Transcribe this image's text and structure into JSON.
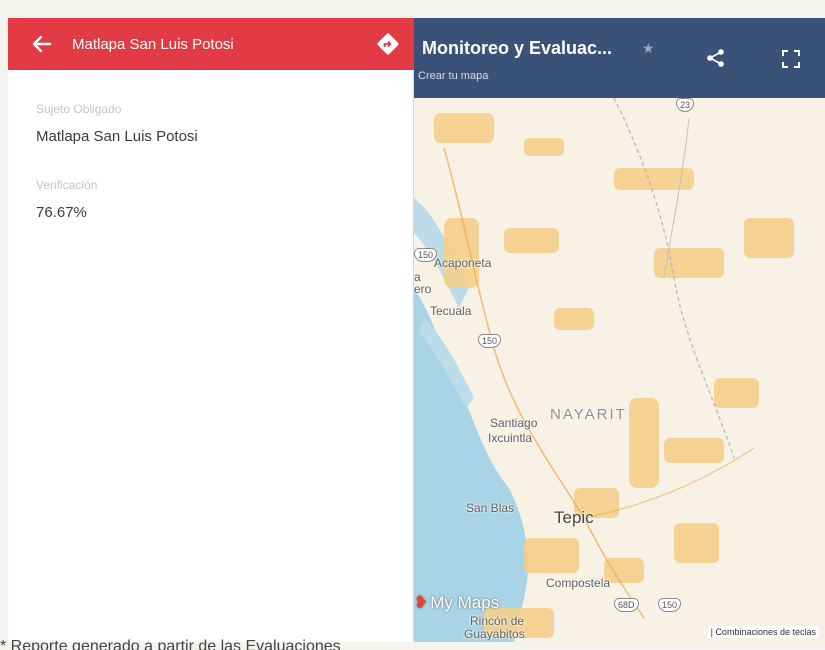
{
  "panel": {
    "title": "Matlapa San Luis Potosi",
    "fields": [
      {
        "label": "Sujeto Obligado",
        "value": "Matlapa San Luis Potosi"
      },
      {
        "label": "Verificación",
        "value": "76.67%"
      }
    ]
  },
  "map": {
    "title": "Monitoreo y Evaluac...",
    "subtitle": "Crear tu mapa",
    "places": [
      "Acaponeta",
      "Tecuala",
      "NAYARIT",
      "Santiago",
      "Ixcuintla",
      "San Blas",
      "Tepic",
      "Compostela",
      "Rincón de",
      "Guayabitos",
      "ero",
      "a"
    ],
    "shields": [
      "23",
      "150",
      "150",
      "68D",
      "150"
    ],
    "brand": "My Maps",
    "keyboard_shortcuts": "Combinaciones de teclas"
  },
  "footer": {
    "note": "* Reporte generado a partir de las Evaluaciones"
  },
  "colors": {
    "panel_header": "#e23b45",
    "map_header": "#3a5178",
    "water": "#a9d3e6",
    "land": "#f7f1e6",
    "urban": "#f5cf8c"
  },
  "icons": [
    "back-arrow-icon",
    "directions-icon",
    "star-icon",
    "share-icon",
    "fullscreen-icon"
  ]
}
